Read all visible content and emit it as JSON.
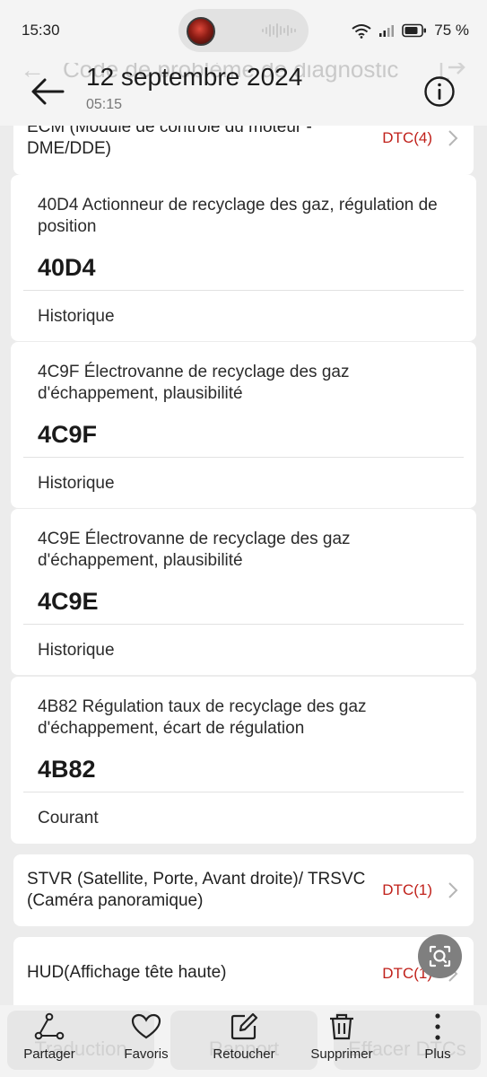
{
  "status_bar": {
    "time": "15:30",
    "battery": "75 %"
  },
  "header": {
    "title": "12 septembre 2024",
    "subtitle": "05:15",
    "background_title": "Code de problème de diagnostic"
  },
  "modules_top": {
    "name": "ECM (Module de contrôle du moteur - DME/DDE)",
    "dtc": "DTC(4)"
  },
  "dtc_cards": [
    {
      "description": "40D4 Actionneur de recyclage des gaz, régulation de position",
      "code": "40D4",
      "status": "Historique"
    },
    {
      "description": "4C9F Électrovanne de recyclage des gaz d'échappement, plausibilité",
      "code": "4C9F",
      "status": "Historique"
    },
    {
      "description": "4C9E Électrovanne de recyclage des gaz d'échappement, plausibilité",
      "code": "4C9E",
      "status": "Historique"
    },
    {
      "description": "4B82 Régulation taux de recyclage des gaz d'échappement, écart de régulation",
      "code": "4B82",
      "status": "Courant"
    }
  ],
  "modules": [
    {
      "name": "STVR (Satellite, Porte, Avant droite)/ TRSVC (Caméra panoramique)",
      "dtc": "DTC(1)"
    },
    {
      "name": "HUD(Affichage tête haute)",
      "dtc": "DTC(1)"
    }
  ],
  "background_buttons": [
    "Traduction",
    "Rapport",
    "Effacer DTCs"
  ],
  "actions": [
    {
      "label": "Partager",
      "icon": "share-icon"
    },
    {
      "label": "Favoris",
      "icon": "heart-icon"
    },
    {
      "label": "Retoucher",
      "icon": "edit-icon"
    },
    {
      "label": "Supprimer",
      "icon": "trash-icon"
    },
    {
      "label": "Plus",
      "icon": "more-icon"
    }
  ],
  "colors": {
    "dtc_red": "#c0201a",
    "background": "#ececec",
    "card": "#ffffff"
  }
}
